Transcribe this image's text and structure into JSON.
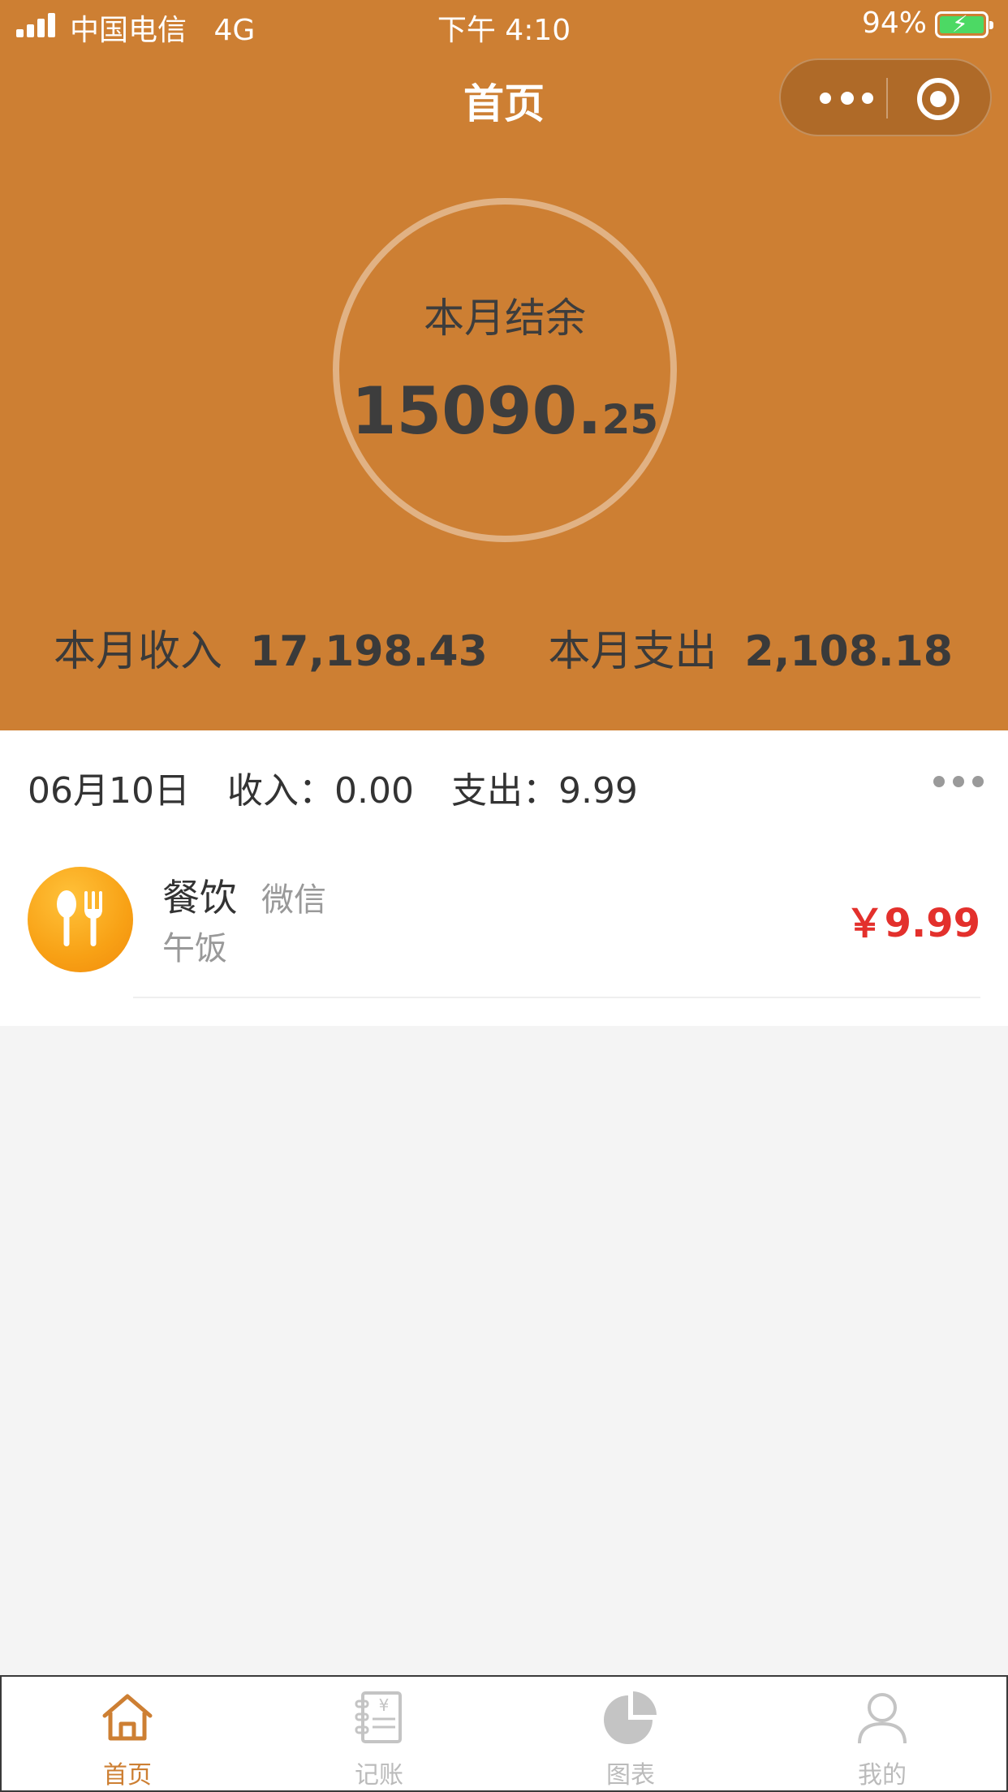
{
  "status_bar": {
    "carrier": "中国电信",
    "network": "4G",
    "time": "下午 4:10",
    "battery": "94%"
  },
  "nav": {
    "title": "首页"
  },
  "summary": {
    "balance_label": "本月结余",
    "balance_int": "15090.",
    "balance_dec": "25",
    "income_label": "本月收入",
    "income_value": "17,198.43",
    "expense_label": "本月支出",
    "expense_value": "2,108.18"
  },
  "day": {
    "date": "06月10日",
    "income": "收入：0.00",
    "expense": "支出：9.99"
  },
  "entries": [
    {
      "icon": "utensils-icon",
      "category": "餐饮",
      "method": "微信",
      "note": "午饭",
      "amount": "￥9.99"
    }
  ],
  "tabs": [
    {
      "label": "首页",
      "icon": "home-icon",
      "active": true
    },
    {
      "label": "记账",
      "icon": "ledger-icon",
      "active": false
    },
    {
      "label": "图表",
      "icon": "pie-chart-icon",
      "active": false
    },
    {
      "label": "我的",
      "icon": "user-icon",
      "active": false
    }
  ],
  "colors": {
    "brand": "#cd7f33",
    "expense_amount": "#e3302c",
    "tab_inactive": "#bbbbbb",
    "background": "#f4f4f4"
  }
}
